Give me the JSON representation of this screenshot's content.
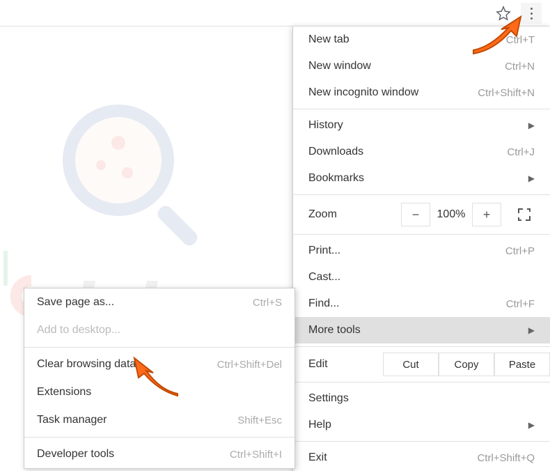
{
  "toolbar": {
    "star": "star-icon",
    "menu": "menu-icon"
  },
  "menu": {
    "new_tab": {
      "label": "New tab",
      "shortcut": "Ctrl+T"
    },
    "new_window": {
      "label": "New window",
      "shortcut": "Ctrl+N"
    },
    "new_incognito": {
      "label": "New incognito window",
      "shortcut": "Ctrl+Shift+N"
    },
    "history": {
      "label": "History"
    },
    "downloads": {
      "label": "Downloads",
      "shortcut": "Ctrl+J"
    },
    "bookmarks": {
      "label": "Bookmarks"
    },
    "zoom": {
      "label": "Zoom",
      "value": "100%",
      "minus": "−",
      "plus": "+"
    },
    "print": {
      "label": "Print...",
      "shortcut": "Ctrl+P"
    },
    "cast": {
      "label": "Cast..."
    },
    "find": {
      "label": "Find...",
      "shortcut": "Ctrl+F"
    },
    "more_tools": {
      "label": "More tools"
    },
    "edit": {
      "label": "Edit",
      "cut": "Cut",
      "copy": "Copy",
      "paste": "Paste"
    },
    "settings": {
      "label": "Settings"
    },
    "help": {
      "label": "Help"
    },
    "exit": {
      "label": "Exit",
      "shortcut": "Ctrl+Shift+Q"
    }
  },
  "submenu": {
    "save_page": {
      "label": "Save page as...",
      "shortcut": "Ctrl+S"
    },
    "add_desktop": {
      "label": "Add to desktop..."
    },
    "clear_data": {
      "label": "Clear browsing data...",
      "shortcut": "Ctrl+Shift+Del"
    },
    "extensions": {
      "label": "Extensions"
    },
    "task_manager": {
      "label": "Task manager",
      "shortcut": "Shift+Esc"
    },
    "dev_tools": {
      "label": "Developer tools",
      "shortcut": "Ctrl+Shift+I"
    }
  },
  "watermark": {
    "text": "risk.com"
  },
  "colors": {
    "arrow": "#ff6a1a",
    "arrow_border": "#c24a00"
  }
}
